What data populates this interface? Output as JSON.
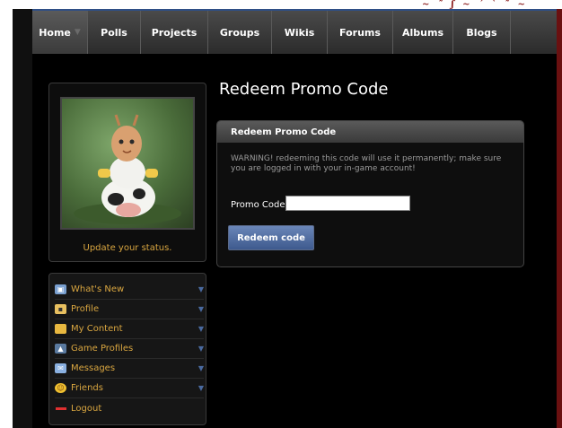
{
  "nav": {
    "items": [
      {
        "label": "Home",
        "active": true
      },
      {
        "label": "Polls"
      },
      {
        "label": "Projects"
      },
      {
        "label": "Groups"
      },
      {
        "label": "Wikis"
      },
      {
        "label": "Forums"
      },
      {
        "label": "Albums"
      },
      {
        "label": "Blogs"
      }
    ]
  },
  "sidebar": {
    "status_link": "Update your status.",
    "menu": [
      {
        "label": "What's New",
        "icon": "whats-new-icon",
        "has_submenu": true
      },
      {
        "label": "Profile",
        "icon": "profile-icon",
        "has_submenu": true
      },
      {
        "label": "My Content",
        "icon": "folder-icon",
        "has_submenu": true
      },
      {
        "label": "Game Profiles",
        "icon": "game-profiles-icon",
        "has_submenu": true
      },
      {
        "label": "Messages",
        "icon": "envelope-icon",
        "has_submenu": true
      },
      {
        "label": "Friends",
        "icon": "smiley-icon",
        "has_submenu": true
      },
      {
        "label": "Logout",
        "icon": "logout-icon",
        "has_submenu": false
      }
    ]
  },
  "main": {
    "title": "Redeem Promo Code",
    "card": {
      "header": "Redeem Promo Code",
      "warning": "WARNING! redeeming this code will use it permanently; make sure you are logged in with your in-game account!",
      "promo_label": "Promo Code:",
      "promo_value": "",
      "button_label": "Redeem code"
    }
  },
  "colors": {
    "link": "#d9a640",
    "button": "#4f6fa3",
    "nav_background": "#3a3a3a"
  }
}
